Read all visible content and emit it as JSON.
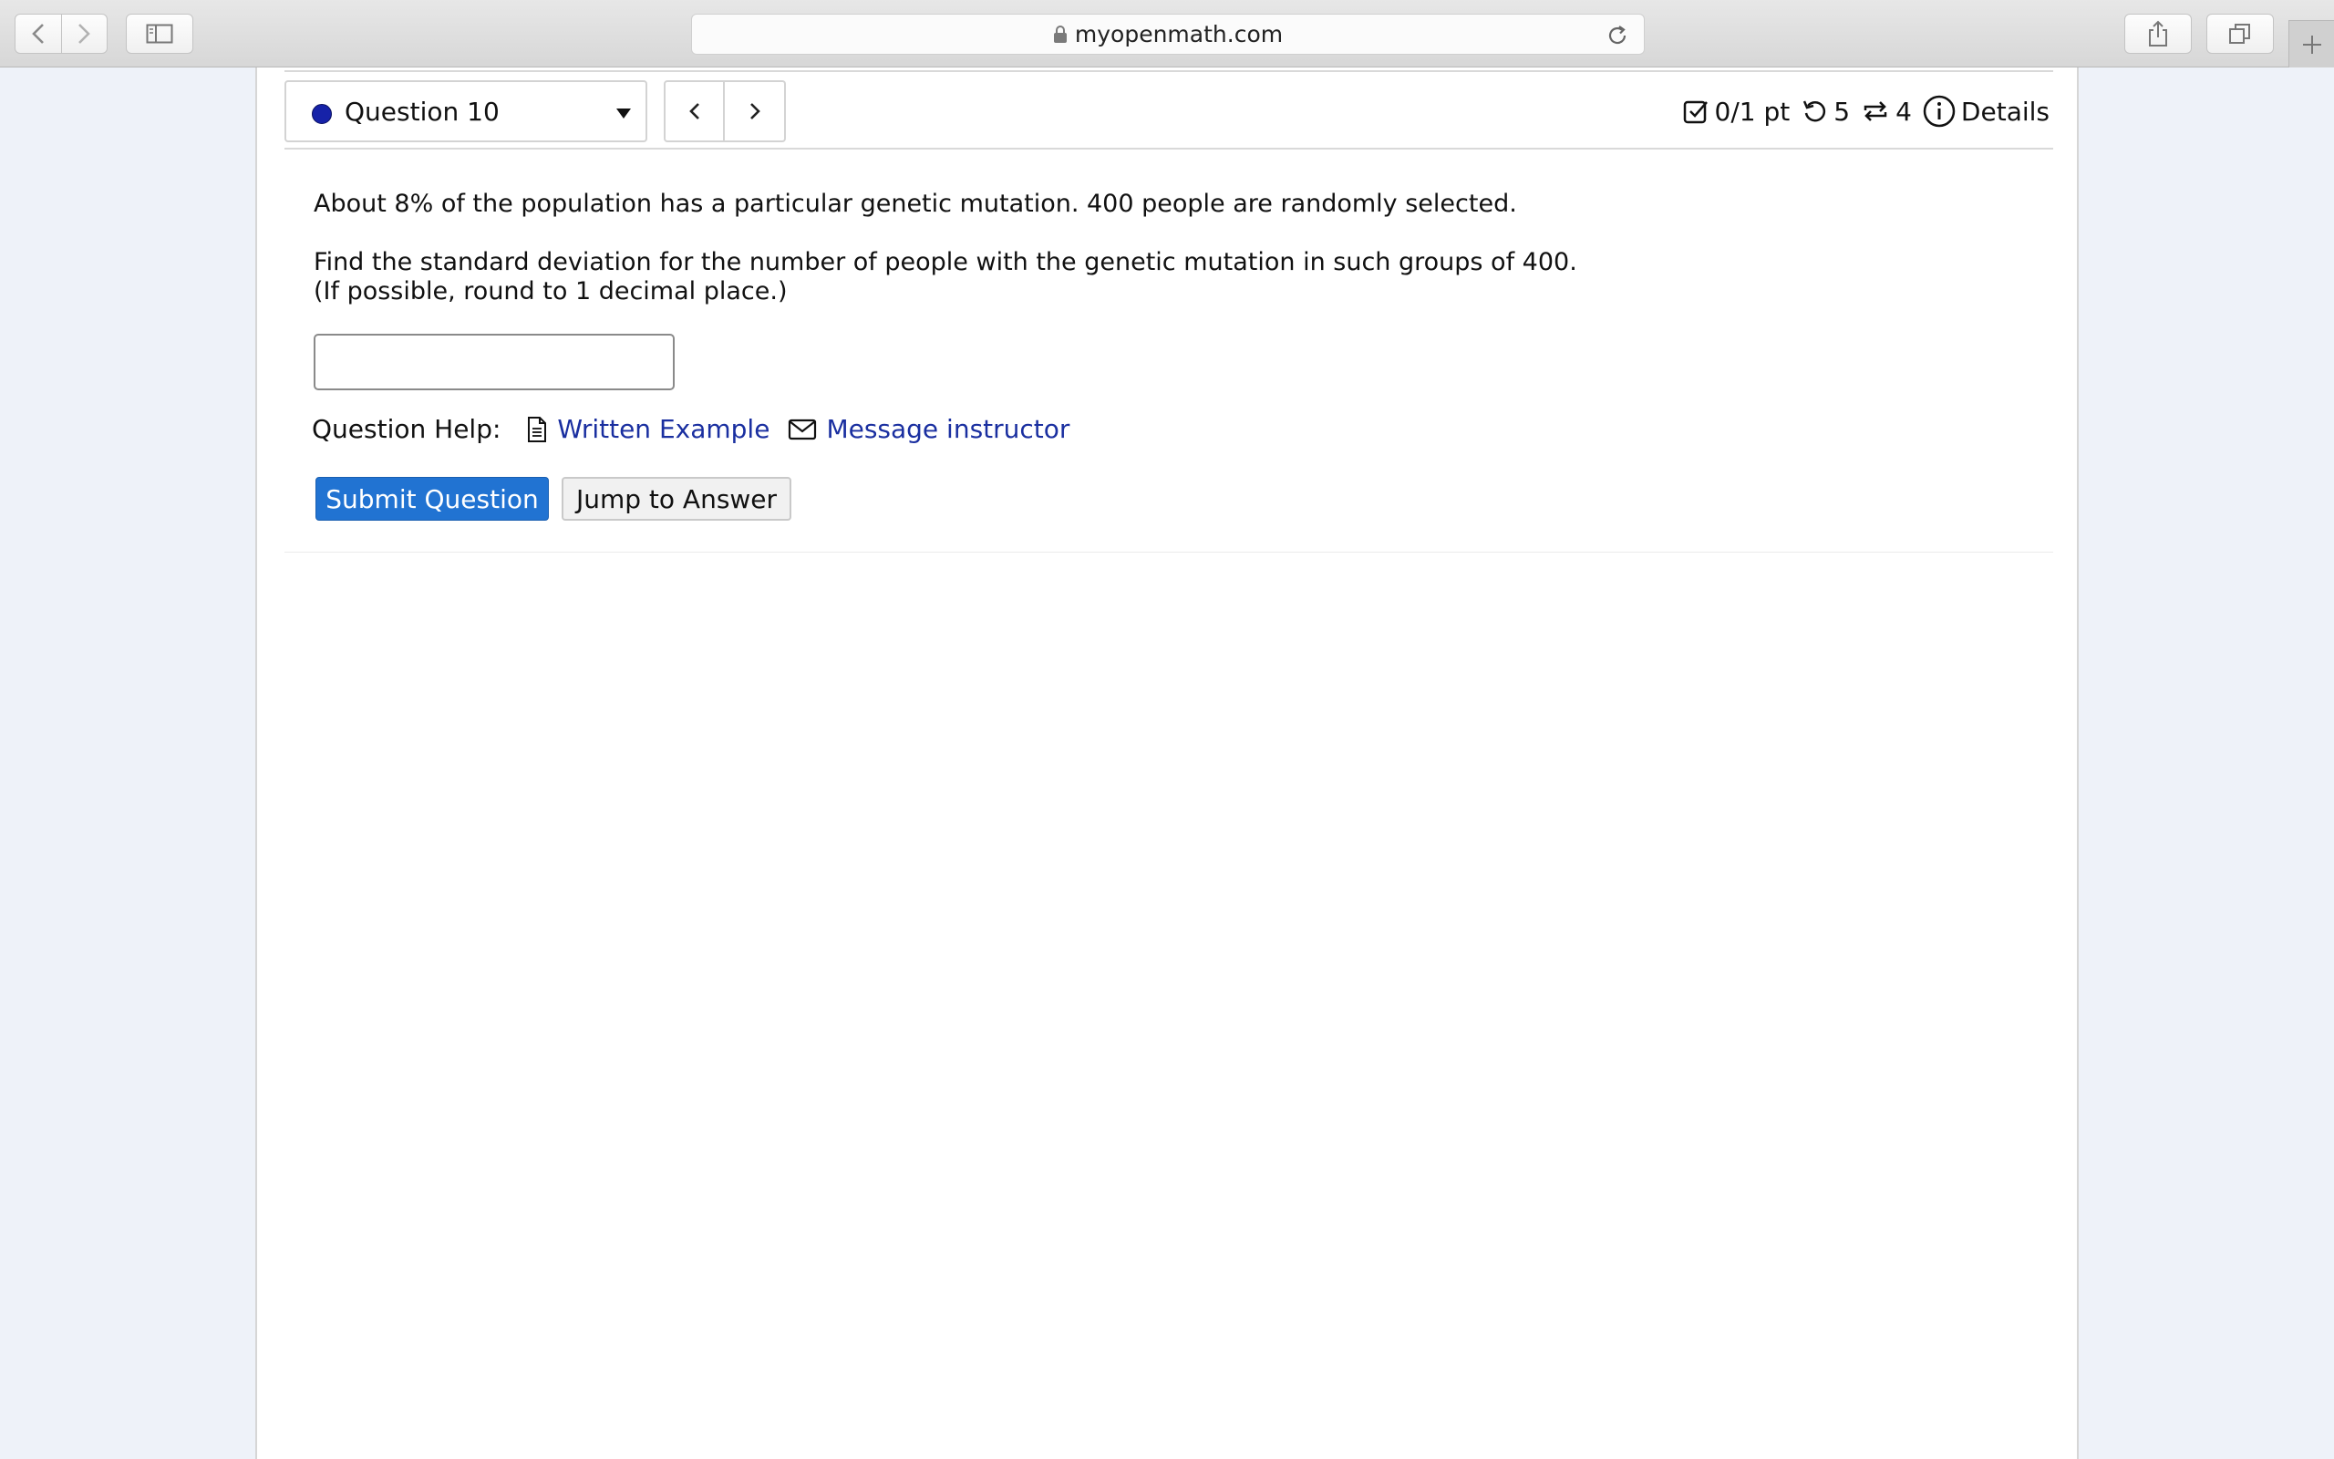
{
  "browser": {
    "url": "myopenmath.com"
  },
  "question_nav": {
    "selected": "Question 10",
    "status_color": "#1622a8"
  },
  "status": {
    "points": "0/1 pt",
    "retries": "5",
    "regenerations": "4",
    "details_label": "Details"
  },
  "question": {
    "line1": "About 8% of the population has a particular genetic mutation. 400 people are randomly selected.",
    "line2": "Find the standard deviation for the number of people with the genetic mutation in such groups of 400.  (If possible, round to 1 decimal place.)",
    "answer_value": ""
  },
  "help": {
    "label": "Question Help:",
    "written_example": "Written Example",
    "message_instructor": "Message instructor"
  },
  "buttons": {
    "submit": "Submit Question",
    "jump": "Jump to Answer"
  },
  "colors": {
    "accent": "#2173d2",
    "link": "#1a2fa0"
  }
}
